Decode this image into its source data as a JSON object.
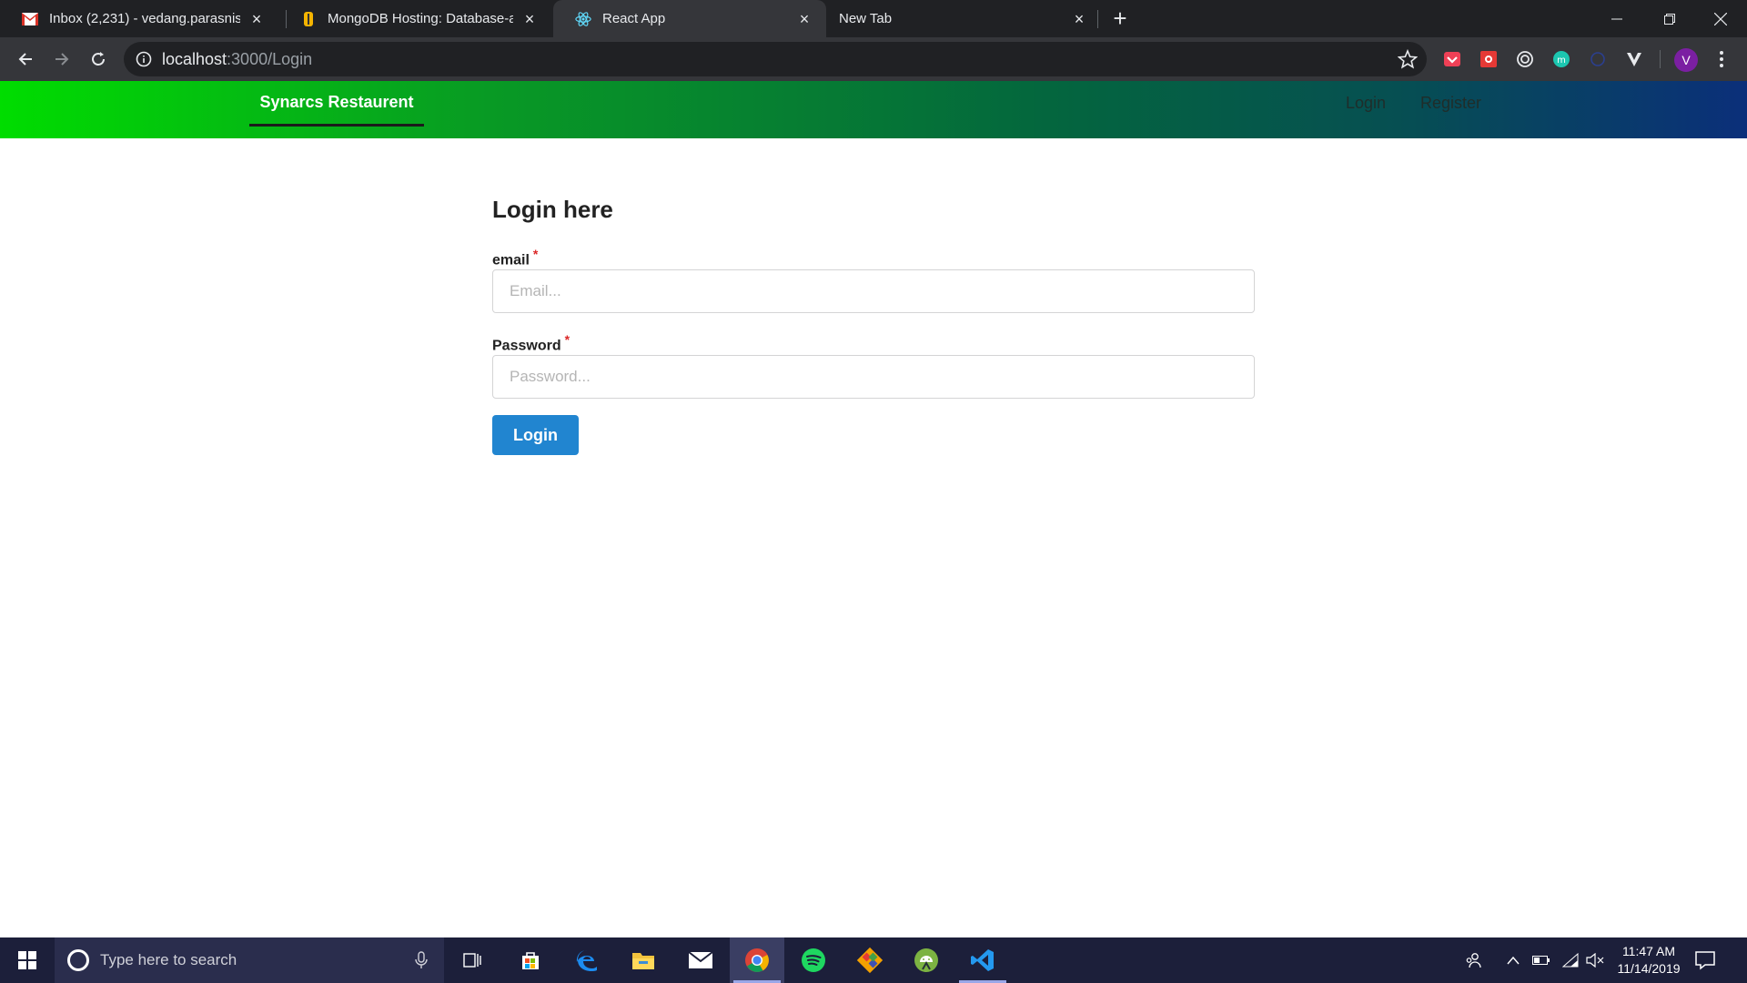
{
  "browser": {
    "tabs": [
      {
        "title": "Inbox (2,231) - vedang.parasnis@",
        "icon": "gmail-icon",
        "active": false
      },
      {
        "title": "MongoDB Hosting: Database-as-",
        "icon": "mongodb-icon",
        "active": false
      },
      {
        "title": "React App",
        "icon": "react-icon",
        "active": true
      },
      {
        "title": "New Tab",
        "icon": "",
        "active": false
      }
    ],
    "new_tab_label": "+",
    "close_glyph": "×",
    "url_host": "localhost",
    "url_path": ":3000/Login",
    "profile_initial": "V"
  },
  "app": {
    "brand": "Synarcs Restaurent",
    "nav": {
      "login": "Login",
      "register": "Register"
    },
    "colors": {
      "gradient_start": "#00dd00",
      "gradient_end": "#0b2f7a",
      "primary_button": "#2185d0",
      "required_marker": "#db2828"
    }
  },
  "login_form": {
    "title": "Login here",
    "email_label": "email",
    "email_placeholder": "Email...",
    "email_value": "",
    "password_label": "Password",
    "password_placeholder": "Password...",
    "password_value": "",
    "required_marker": "*",
    "submit_label": "Login"
  },
  "taskbar": {
    "search_placeholder": "Type here to search",
    "apps": [
      "task-view-icon",
      "store-icon",
      "edge-icon",
      "file-explorer-icon",
      "mail-icon",
      "chrome-icon",
      "spotify-icon",
      "git-icon",
      "android-studio-icon",
      "vscode-icon"
    ],
    "time": "11:47 AM",
    "date": "11/14/2019"
  }
}
